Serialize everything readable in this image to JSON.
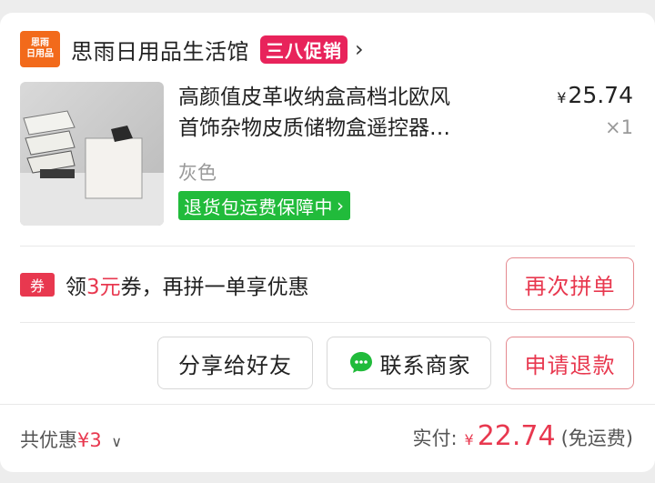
{
  "shop": {
    "logo_line1": "思雨",
    "logo_line2": "日用品",
    "name": "思雨日用品生活馆",
    "promo": "三八促销"
  },
  "product": {
    "title_line1": "高颜值皮革收纳盒高档北欧风",
    "title_line2": "首饰杂物皮质储物盒遥控器…",
    "price_symbol": "¥",
    "price": "25.74",
    "quantity": "×1",
    "variant": "灰色",
    "guarantee": "退货包运费保障中"
  },
  "coupon": {
    "tag": "券",
    "prefix": "领",
    "amount": "3元",
    "suffix": "券，再拼一单享优惠"
  },
  "buttons": {
    "regroup": "再次拼单",
    "share": "分享给好友",
    "contact": "联系商家",
    "refund": "申请退款"
  },
  "footer": {
    "discount_label": "共优惠",
    "discount_amount": "¥3",
    "paid_label": "实付:",
    "currency": "¥",
    "paid_amount": "22.74",
    "shipping_note": "(免运费)"
  },
  "colors": {
    "accent_red": "#e8384f",
    "promo_pink": "#e8235b",
    "guarantee_green": "#21bb3b",
    "logo_orange": "#f26a1b"
  },
  "icons": {
    "shop_chevron": "chevron-right-icon",
    "contact": "wechat-chat-icon",
    "discount_toggle": "chevron-down-icon"
  }
}
